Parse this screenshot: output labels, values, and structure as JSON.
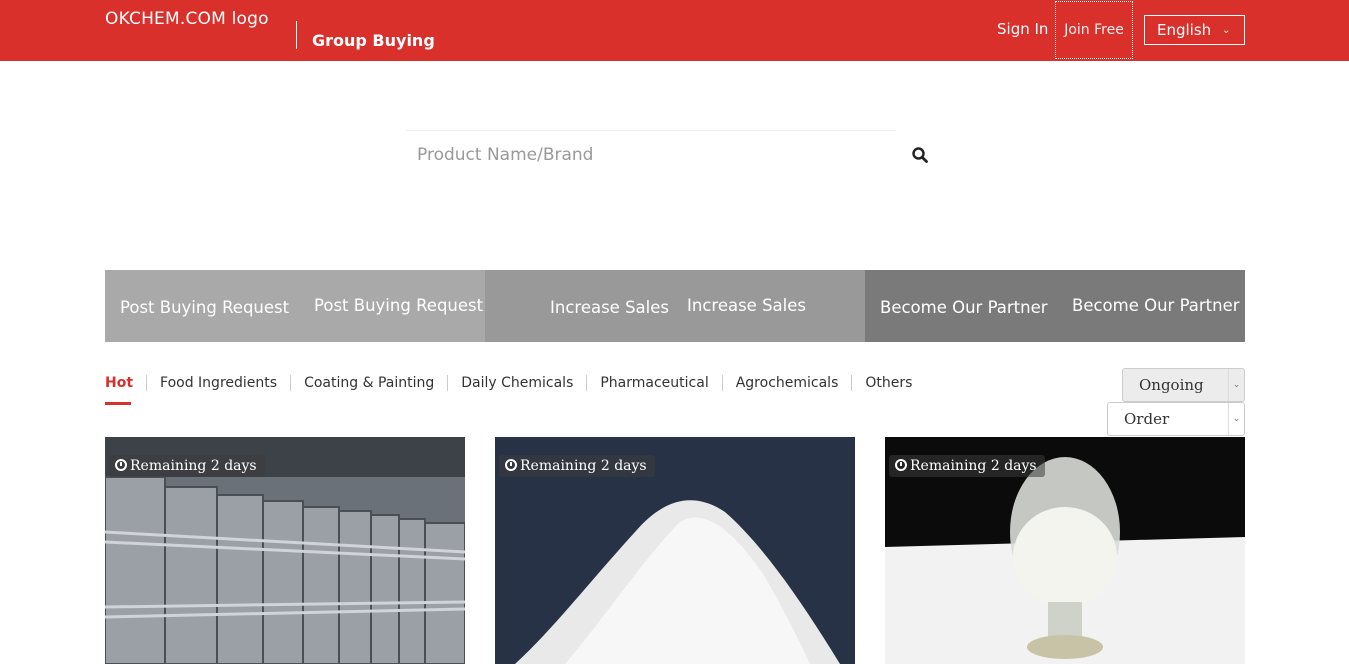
{
  "header": {
    "logo_text": "OKCHEM.COM logo",
    "section_title": "Group Buying",
    "sign_in": "Sign In",
    "join_free": "Join Free",
    "language": "English"
  },
  "search": {
    "placeholder": "Product Name/Brand"
  },
  "banners": [
    {
      "label_a": "Post Buying Request",
      "label_b": "Post Buying Request"
    },
    {
      "label_a": "Increase Sales",
      "label_b": "Increase Sales"
    },
    {
      "label_a": "Become Our Partner",
      "label_b": "Become Our Partner"
    }
  ],
  "tabs": [
    {
      "label": "Hot"
    },
    {
      "label": "Food Ingredients"
    },
    {
      "label": "Coating & Painting"
    },
    {
      "label": "Daily Chemicals"
    },
    {
      "label": "Pharmaceutical"
    },
    {
      "label": "Agrochemicals"
    },
    {
      "label": "Others"
    }
  ],
  "filters": {
    "status": "Ongoing",
    "sort": "Order"
  },
  "products": [
    {
      "remaining": "Remaining 2 days"
    },
    {
      "remaining": "Remaining 2 days"
    },
    {
      "remaining": "Remaining 2 days"
    }
  ],
  "colors": {
    "brand_red": "#d9302c",
    "banner_1": "#a9a9a9",
    "banner_2": "#999999",
    "banner_3": "#7a7a7a"
  }
}
